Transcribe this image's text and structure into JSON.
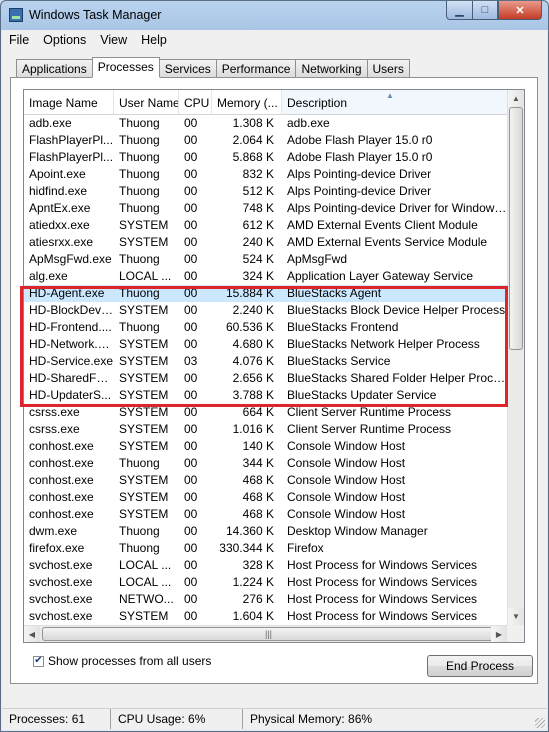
{
  "window": {
    "title": "Windows Task Manager",
    "min_glyph": "▁",
    "max_glyph": "□",
    "close_glyph": "✕"
  },
  "menu": [
    "File",
    "Options",
    "View",
    "Help"
  ],
  "tabs": [
    {
      "label": "Applications",
      "active": false
    },
    {
      "label": "Processes",
      "active": true
    },
    {
      "label": "Services",
      "active": false
    },
    {
      "label": "Performance",
      "active": false
    },
    {
      "label": "Networking",
      "active": false
    },
    {
      "label": "Users",
      "active": false
    }
  ],
  "columns": [
    "Image Name",
    "User Name",
    "CPU",
    "Memory (...",
    "Description"
  ],
  "sorted_column": "Description",
  "processes": [
    {
      "name": "adb.exe",
      "user": "Thuong",
      "cpu": "00",
      "mem": "1.308 K",
      "desc": "adb.exe"
    },
    {
      "name": "FlashPlayerPl...",
      "user": "Thuong",
      "cpu": "00",
      "mem": "2.064 K",
      "desc": "Adobe Flash Player 15.0 r0"
    },
    {
      "name": "FlashPlayerPl...",
      "user": "Thuong",
      "cpu": "00",
      "mem": "5.868 K",
      "desc": "Adobe Flash Player 15.0 r0"
    },
    {
      "name": "Apoint.exe",
      "user": "Thuong",
      "cpu": "00",
      "mem": "832 K",
      "desc": "Alps Pointing-device Driver"
    },
    {
      "name": "hidfind.exe",
      "user": "Thuong",
      "cpu": "00",
      "mem": "512 K",
      "desc": "Alps Pointing-device Driver"
    },
    {
      "name": "ApntEx.exe",
      "user": "Thuong",
      "cpu": "00",
      "mem": "748 K",
      "desc": "Alps Pointing-device Driver for Windows ..."
    },
    {
      "name": "atiedxx.exe",
      "user": "SYSTEM",
      "cpu": "00",
      "mem": "612 K",
      "desc": "AMD External Events Client Module"
    },
    {
      "name": "atiesrxx.exe",
      "user": "SYSTEM",
      "cpu": "00",
      "mem": "240 K",
      "desc": "AMD External Events Service Module"
    },
    {
      "name": "ApMsgFwd.exe",
      "user": "Thuong",
      "cpu": "00",
      "mem": "524 K",
      "desc": "ApMsgFwd"
    },
    {
      "name": "alg.exe",
      "user": "LOCAL ...",
      "cpu": "00",
      "mem": "324 K",
      "desc": "Application Layer Gateway Service"
    },
    {
      "name": "HD-Agent.exe",
      "user": "Thuong",
      "cpu": "00",
      "mem": "15.884 K",
      "desc": "BlueStacks Agent",
      "selected": true
    },
    {
      "name": "HD-BlockDevic...",
      "user": "SYSTEM",
      "cpu": "00",
      "mem": "2.240 K",
      "desc": "BlueStacks Block Device Helper Process"
    },
    {
      "name": "HD-Frontend....",
      "user": "Thuong",
      "cpu": "00",
      "mem": "60.536 K",
      "desc": "BlueStacks Frontend"
    },
    {
      "name": "HD-Network.exe",
      "user": "SYSTEM",
      "cpu": "00",
      "mem": "4.680 K",
      "desc": "BlueStacks Network Helper Process"
    },
    {
      "name": "HD-Service.exe",
      "user": "SYSTEM",
      "cpu": "03",
      "mem": "4.076 K",
      "desc": "BlueStacks Service"
    },
    {
      "name": "HD-SharedFol...",
      "user": "SYSTEM",
      "cpu": "00",
      "mem": "2.656 K",
      "desc": "BlueStacks Shared Folder Helper Process"
    },
    {
      "name": "HD-UpdaterS...",
      "user": "SYSTEM",
      "cpu": "00",
      "mem": "3.788 K",
      "desc": "BlueStacks Updater Service"
    },
    {
      "name": "csrss.exe",
      "user": "SYSTEM",
      "cpu": "00",
      "mem": "664 K",
      "desc": "Client Server Runtime Process"
    },
    {
      "name": "csrss.exe",
      "user": "SYSTEM",
      "cpu": "00",
      "mem": "1.016 K",
      "desc": "Client Server Runtime Process"
    },
    {
      "name": "conhost.exe",
      "user": "SYSTEM",
      "cpu": "00",
      "mem": "140 K",
      "desc": "Console Window Host"
    },
    {
      "name": "conhost.exe",
      "user": "Thuong",
      "cpu": "00",
      "mem": "344 K",
      "desc": "Console Window Host"
    },
    {
      "name": "conhost.exe",
      "user": "SYSTEM",
      "cpu": "00",
      "mem": "468 K",
      "desc": "Console Window Host"
    },
    {
      "name": "conhost.exe",
      "user": "SYSTEM",
      "cpu": "00",
      "mem": "468 K",
      "desc": "Console Window Host"
    },
    {
      "name": "conhost.exe",
      "user": "SYSTEM",
      "cpu": "00",
      "mem": "468 K",
      "desc": "Console Window Host"
    },
    {
      "name": "dwm.exe",
      "user": "Thuong",
      "cpu": "00",
      "mem": "14.360 K",
      "desc": "Desktop Window Manager"
    },
    {
      "name": "firefox.exe",
      "user": "Thuong",
      "cpu": "00",
      "mem": "330.344 K",
      "desc": "Firefox"
    },
    {
      "name": "svchost.exe",
      "user": "LOCAL ...",
      "cpu": "00",
      "mem": "328 K",
      "desc": "Host Process for Windows Services"
    },
    {
      "name": "svchost.exe",
      "user": "LOCAL ...",
      "cpu": "00",
      "mem": "1.224 K",
      "desc": "Host Process for Windows Services"
    },
    {
      "name": "svchost.exe",
      "user": "NETWO...",
      "cpu": "00",
      "mem": "276 K",
      "desc": "Host Process for Windows Services"
    },
    {
      "name": "svchost.exe",
      "user": "SYSTEM",
      "cpu": "00",
      "mem": "1.604 K",
      "desc": "Host Process for Windows Services"
    }
  ],
  "show_all": {
    "label": "Show processes from all users",
    "checked": true,
    "check_glyph": "✔"
  },
  "end_process_label": "End Process",
  "status": {
    "processes": "Processes: 61",
    "cpu": "CPU Usage: 6%",
    "memory": "Physical Memory: 86%"
  },
  "colors": {
    "selected_row": "#cce8ff",
    "highlight_box": "#e0242b",
    "title_bar": "#b9d3ee"
  },
  "scroll_glyphs": {
    "up": "▲",
    "down": "▼",
    "left": "◀",
    "right": "▶",
    "grip": "|||",
    "sort": "▲"
  }
}
